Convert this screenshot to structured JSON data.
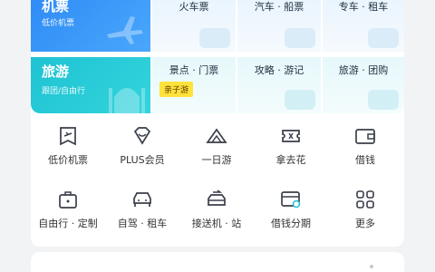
{
  "banner": {
    "flight": {
      "title": "机票",
      "subtitle": "低价机票"
    },
    "travel": {
      "title": "旅游",
      "subtitle": "跟团/自由行"
    },
    "top_items": [
      {
        "label": "火车票"
      },
      {
        "label": "汽车 · 船票"
      },
      {
        "label": "专车 · 租车"
      }
    ],
    "bottom_items": [
      {
        "label": "景点 · 门票",
        "badge": "亲子游"
      },
      {
        "label": "攻略 · 游记"
      },
      {
        "label": "旅游 · 团购"
      }
    ]
  },
  "services": {
    "row1": [
      {
        "label": "低价机票",
        "icon": "ticket-icon"
      },
      {
        "label": "PLUS会员",
        "icon": "diamond-icon"
      },
      {
        "label": "一日游",
        "icon": "mountain-icon"
      },
      {
        "label": "拿去花",
        "icon": "coupon-icon"
      },
      {
        "label": "借钱",
        "icon": "wallet-icon"
      }
    ],
    "row2": [
      {
        "label": "自由行 · 定制",
        "icon": "suitcase-icon"
      },
      {
        "label": "自驾 · 租车",
        "icon": "car-icon"
      },
      {
        "label": "接送机 · 站",
        "icon": "shuttle-icon"
      },
      {
        "label": "借钱分期",
        "icon": "card-icon"
      },
      {
        "label": "更多",
        "icon": "grid-icon"
      }
    ]
  },
  "colors": {
    "flight_tile": "#2f8cf6",
    "travel_tile": "#1ec3d3",
    "badge": "#ffe23b"
  }
}
